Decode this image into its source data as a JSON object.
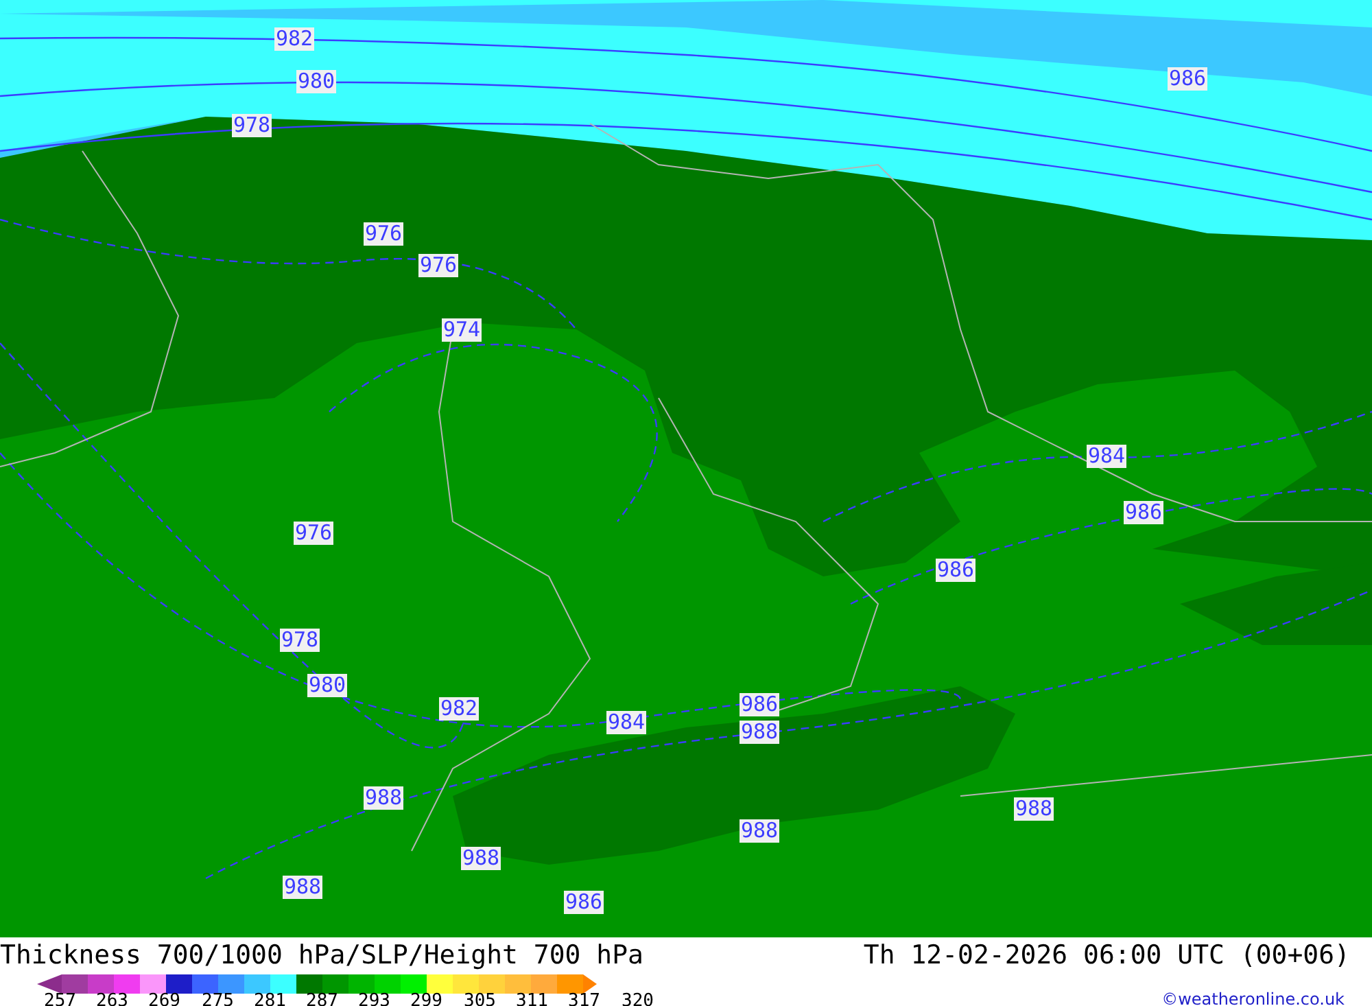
{
  "map": {
    "isobar_labels": [
      {
        "text": "982"
      },
      {
        "text": "980"
      },
      {
        "text": "978"
      },
      {
        "text": "986"
      },
      {
        "text": "976"
      },
      {
        "text": "976"
      },
      {
        "text": "974"
      },
      {
        "text": "984"
      },
      {
        "text": "986"
      },
      {
        "text": "976"
      },
      {
        "text": "986"
      },
      {
        "text": "978"
      },
      {
        "text": "980"
      },
      {
        "text": "982"
      },
      {
        "text": "984"
      },
      {
        "text": "986"
      },
      {
        "text": "988"
      },
      {
        "text": "988"
      },
      {
        "text": "988"
      },
      {
        "text": "988"
      },
      {
        "text": "988"
      },
      {
        "text": "988"
      },
      {
        "text": "986"
      }
    ]
  },
  "footer": {
    "title": "Thickness 700/1000 hPa/SLP/Height 700 hPa",
    "datetime": "Th 12-02-2026 06:00 UTC (00+06)",
    "credit": "©weatheronline.co.uk"
  },
  "legend": {
    "swatches": [
      {
        "color": "#a03ca0"
      },
      {
        "color": "#c83cc8"
      },
      {
        "color": "#f03cf0"
      },
      {
        "color": "#fa96fa"
      },
      {
        "color": "#1e1ec8"
      },
      {
        "color": "#3c64ff"
      },
      {
        "color": "#3c96ff"
      },
      {
        "color": "#3cc8ff"
      },
      {
        "color": "#3cffff"
      },
      {
        "color": "#007800"
      },
      {
        "color": "#009600"
      },
      {
        "color": "#00b400"
      },
      {
        "color": "#00d200"
      },
      {
        "color": "#00f000"
      },
      {
        "color": "#ffff3c"
      },
      {
        "color": "#ffe63c"
      },
      {
        "color": "#ffd23c"
      },
      {
        "color": "#ffbe3c"
      },
      {
        "color": "#ffaa3c"
      },
      {
        "color": "#ff9600"
      }
    ],
    "ends": [
      {
        "color": "#8c2d8c"
      },
      {
        "color": "#ff8200"
      }
    ],
    "ticks": [
      "257",
      "263",
      "269",
      "275",
      "281",
      "287",
      "293",
      "299",
      "305",
      "311",
      "317",
      "320"
    ]
  }
}
